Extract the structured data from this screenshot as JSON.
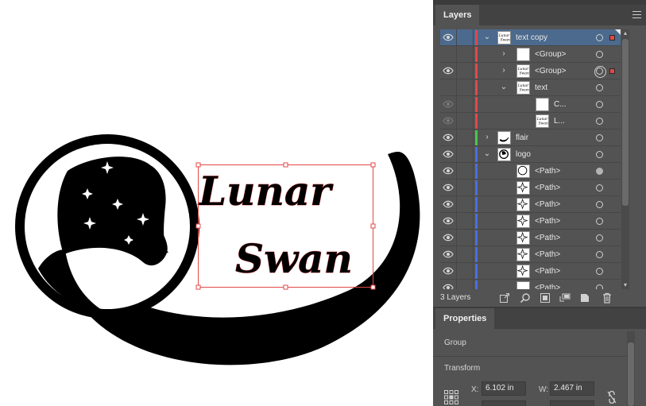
{
  "artwork": {
    "line1": "Lunar",
    "line2": "Swan"
  },
  "layers_panel": {
    "tab_label": "Layers",
    "footer_count": "3 Layers",
    "selection_color": "#4b6a8d",
    "rows": [
      {
        "name": "text copy",
        "color": "#e34848",
        "visible": true
      },
      {
        "name": "<Group>",
        "color": "#e34848",
        "visible": false
      },
      {
        "name": "<Group>",
        "color": "#e34848",
        "visible": true
      },
      {
        "name": "text",
        "color": "#e34848",
        "visible": false
      },
      {
        "name": "C...",
        "color": "#e34848",
        "visible": "dim"
      },
      {
        "name": "L...",
        "color": "#e34848",
        "visible": "dim"
      },
      {
        "name": "flair",
        "color": "#46c84a",
        "visible": true
      },
      {
        "name": "logo",
        "color": "#4a6fe3",
        "visible": true
      },
      {
        "name": "<Path>",
        "color": "#4a6fe3",
        "visible": true
      },
      {
        "name": "<Path>",
        "color": "#4a6fe3",
        "visible": true
      },
      {
        "name": "<Path>",
        "color": "#4a6fe3",
        "visible": true
      },
      {
        "name": "<Path>",
        "color": "#4a6fe3",
        "visible": true
      },
      {
        "name": "<Path>",
        "color": "#4a6fe3",
        "visible": true
      },
      {
        "name": "<Path>",
        "color": "#4a6fe3",
        "visible": true
      },
      {
        "name": "<Path>",
        "color": "#4a6fe3",
        "visible": true
      },
      {
        "name": "<Path>",
        "color": "#4a6fe3",
        "visible": true
      }
    ]
  },
  "properties_panel": {
    "tab_label": "Properties",
    "object_type": "Group",
    "transform_label": "Transform",
    "x_label": "X:",
    "x_value": "6.102 in",
    "w_label": "W:",
    "w_value": "2.467 in"
  }
}
